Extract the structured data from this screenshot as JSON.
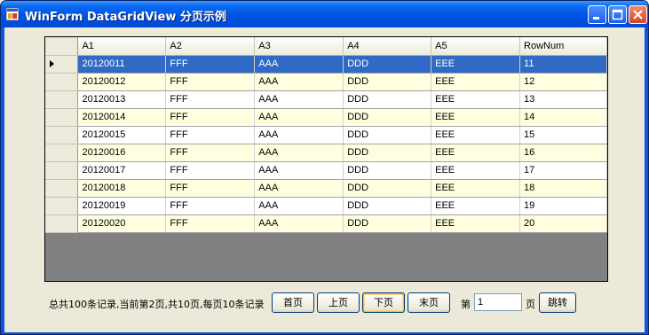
{
  "window": {
    "title": "WinForm DataGridView 分页示例"
  },
  "colors": {
    "titlebar": "#0054e3",
    "selection": "#316ac5",
    "alt_row": "#ffffe0",
    "grid_background": "#808080",
    "client": "#ece9d8"
  },
  "grid": {
    "columns": [
      "A1",
      "A2",
      "A3",
      "A4",
      "A5",
      "RowNum"
    ],
    "selected_row": 0,
    "rows": [
      [
        "20120011",
        "FFF",
        "AAA",
        "DDD",
        "EEE",
        "11"
      ],
      [
        "20120012",
        "FFF",
        "AAA",
        "DDD",
        "EEE",
        "12"
      ],
      [
        "20120013",
        "FFF",
        "AAA",
        "DDD",
        "EEE",
        "13"
      ],
      [
        "20120014",
        "FFF",
        "AAA",
        "DDD",
        "EEE",
        "14"
      ],
      [
        "20120015",
        "FFF",
        "AAA",
        "DDD",
        "EEE",
        "15"
      ],
      [
        "20120016",
        "FFF",
        "AAA",
        "DDD",
        "EEE",
        "16"
      ],
      [
        "20120017",
        "FFF",
        "AAA",
        "DDD",
        "EEE",
        "17"
      ],
      [
        "20120018",
        "FFF",
        "AAA",
        "DDD",
        "EEE",
        "18"
      ],
      [
        "20120019",
        "FFF",
        "AAA",
        "DDD",
        "EEE",
        "19"
      ],
      [
        "20120020",
        "FFF",
        "AAA",
        "DDD",
        "EEE",
        "20"
      ]
    ]
  },
  "pager": {
    "status": "总共100条记录,当前第2页,共10页,每页10条记录",
    "first_label": "首页",
    "prev_label": "上页",
    "next_label": "下页",
    "last_label": "末页",
    "page_prefix": "第",
    "page_value": "1",
    "page_suffix": "页",
    "go_label": "跳转"
  }
}
